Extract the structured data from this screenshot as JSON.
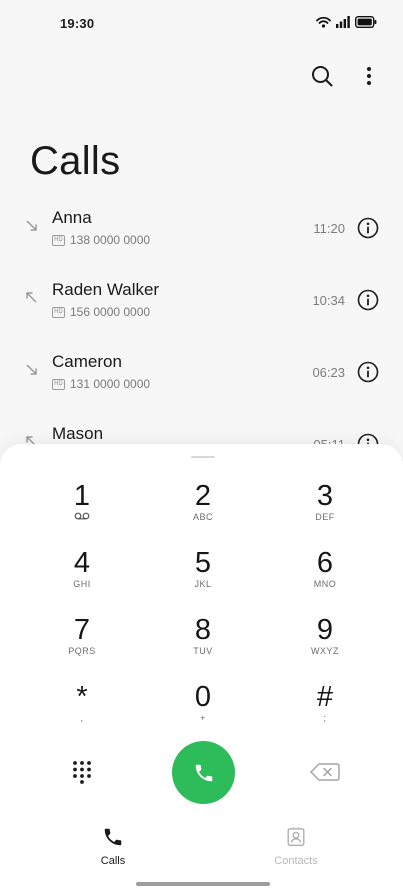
{
  "status_bar": {
    "time": "19:30",
    "icons": [
      "wifi-icon",
      "signal-icon",
      "battery-icon"
    ]
  },
  "toolbar": {
    "search_icon": "search-icon",
    "more_icon": "more-vertical-icon"
  },
  "page": {
    "title": "Calls"
  },
  "calls": [
    {
      "name": "Anna",
      "number": "138 0000 0000",
      "time": "11:20",
      "direction": "incoming",
      "badge": "HD"
    },
    {
      "name": "Raden Walker",
      "number": "156 0000 0000",
      "time": "10:34",
      "direction": "outgoing",
      "badge": "HD"
    },
    {
      "name": "Cameron",
      "number": "131 0000 0000",
      "time": "06:23",
      "direction": "incoming",
      "badge": "HD"
    },
    {
      "name": "Mason",
      "number": "",
      "time": "05:11",
      "direction": "outgoing",
      "badge": "HD"
    }
  ],
  "dialpad": {
    "keys": [
      {
        "digit": "1",
        "letters": ""
      },
      {
        "digit": "2",
        "letters": "ABC"
      },
      {
        "digit": "3",
        "letters": "DEF"
      },
      {
        "digit": "4",
        "letters": "GHI"
      },
      {
        "digit": "5",
        "letters": "JKL"
      },
      {
        "digit": "6",
        "letters": "MNO"
      },
      {
        "digit": "7",
        "letters": "PQRS"
      },
      {
        "digit": "8",
        "letters": "TUV"
      },
      {
        "digit": "9",
        "letters": "WXYZ"
      },
      {
        "digit": "*",
        "letters": ","
      },
      {
        "digit": "0",
        "letters": "+"
      },
      {
        "digit": "#",
        "letters": ";"
      }
    ],
    "call_button_color": "#2ebb59"
  },
  "bottom_nav": {
    "tabs": [
      {
        "label": "Calls",
        "icon": "phone-icon",
        "active": true
      },
      {
        "label": "Contacts",
        "icon": "contacts-icon",
        "active": false
      }
    ],
    "active_color": "#1b1b1b",
    "inactive_color": "#b8b8b8"
  }
}
